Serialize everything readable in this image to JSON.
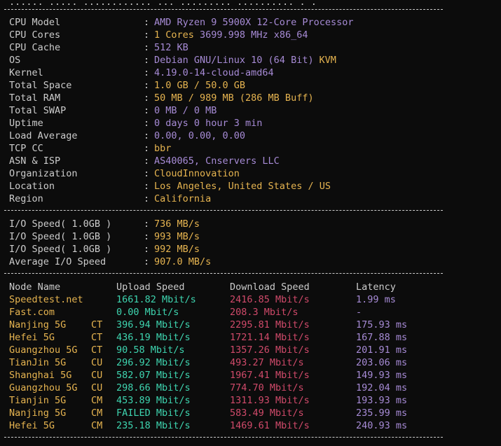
{
  "colors": {
    "background": "#0c0c0c",
    "label": "#cccccc",
    "purple": "#a78bd6",
    "yellow": "#e6b450",
    "green": "#3ed5b0",
    "red": "#d04a6a"
  },
  "top_partial": "...... ..... ............ ... ......... .......... . .",
  "system": [
    {
      "label": "CPU Model",
      "value": "AMD Ryzen 9 5900X 12-Core Processor",
      "color": "purple"
    },
    {
      "label": "CPU Cores",
      "value": "1 Cores 3699.998 MHz x86_64",
      "color": "purple",
      "value_prefix": "1 Cores ",
      "prefix_color": "yellow"
    },
    {
      "label": "CPU Cache",
      "value": "512 KB",
      "color": "purple"
    },
    {
      "label": "OS",
      "value": "Debian GNU/Linux 10 (64 Bit)",
      "color": "purple",
      "suffix": "KVM",
      "suffix_color": "yellow"
    },
    {
      "label": "Kernel",
      "value": "4.19.0-14-cloud-amd64",
      "color": "purple"
    },
    {
      "label": "Total Space",
      "value": "1.0 GB / 50.0 GB",
      "color": "yellow"
    },
    {
      "label": "Total RAM",
      "value": "50 MB / 989 MB (286 MB Buff)",
      "color": "yellow"
    },
    {
      "label": "Total SWAP",
      "value": "0 MB / 0 MB",
      "color": "purple"
    },
    {
      "label": "Uptime",
      "value": "0 days 0 hour 3 min",
      "color": "purple"
    },
    {
      "label": "Load Average",
      "value": "0.00, 0.00, 0.00",
      "color": "purple"
    },
    {
      "label": "TCP CC",
      "value": "bbr",
      "color": "yellow"
    },
    {
      "label": "ASN & ISP",
      "value": "AS40065, Cnservers LLC",
      "color": "purple"
    },
    {
      "label": "Organization",
      "value": "CloudInnovation",
      "color": "yellow"
    },
    {
      "label": "Location",
      "value": "Los Angeles, United States / US",
      "color": "yellow"
    },
    {
      "label": "Region",
      "value": "California",
      "color": "yellow"
    }
  ],
  "io": [
    {
      "label": "I/O Speed( 1.0GB )",
      "value": "736 MB/s"
    },
    {
      "label": "I/O Speed( 1.0GB )",
      "value": "993 MB/s"
    },
    {
      "label": "I/O Speed( 1.0GB )",
      "value": "992 MB/s"
    },
    {
      "label": "Average I/O Speed",
      "value": "907.0 MB/s"
    }
  ],
  "speed_headers": {
    "node": "Node Name",
    "upload": "Upload Speed",
    "download": "Download Speed",
    "latency": "Latency"
  },
  "speed_rows": [
    {
      "node": "Speedtest.net",
      "isp": "",
      "upload": "1661.82 Mbit/s",
      "download": "2416.85 Mbit/s",
      "latency": "1.99 ms",
      "latency_color": "purple"
    },
    {
      "node": "Fast.com",
      "isp": "",
      "upload": "0.00 Mbit/s",
      "download": "208.3 Mbit/s",
      "latency": "-",
      "latency_color": "purple"
    },
    {
      "node": "Nanjing 5G",
      "isp": "CT",
      "upload": "396.94 Mbit/s",
      "download": "2295.81 Mbit/s",
      "latency": "175.93 ms"
    },
    {
      "node": "Hefei 5G",
      "isp": "CT",
      "upload": "436.19 Mbit/s",
      "download": "1721.14 Mbit/s",
      "latency": "167.88 ms"
    },
    {
      "node": "Guangzhou 5G",
      "isp": "CT",
      "upload": "90.58 Mbit/s",
      "download": "1357.26 Mbit/s",
      "latency": "201.91 ms"
    },
    {
      "node": "TianJin 5G",
      "isp": "CU",
      "upload": "296.92 Mbit/s",
      "download": "493.27 Mbit/s",
      "latency": "203.06 ms"
    },
    {
      "node": "Shanghai 5G",
      "isp": "CU",
      "upload": "582.07 Mbit/s",
      "download": "1967.41 Mbit/s",
      "latency": "149.93 ms"
    },
    {
      "node": "Guangzhou 5G",
      "isp": "CU",
      "upload": "298.66 Mbit/s",
      "download": "774.70 Mbit/s",
      "latency": "192.04 ms"
    },
    {
      "node": "Tianjin 5G",
      "isp": "CM",
      "upload": "453.89 Mbit/s",
      "download": "1311.93 Mbit/s",
      "latency": "193.93 ms"
    },
    {
      "node": "Nanjing 5G",
      "isp": "CM",
      "upload": "FAILED Mbit/s",
      "download": "583.49 Mbit/s",
      "latency": "235.99 ms"
    },
    {
      "node": "Hefei 5G",
      "isp": "CM",
      "upload": "235.18 Mbit/s",
      "download": "1469.61 Mbit/s",
      "latency": "240.93 ms"
    }
  ]
}
